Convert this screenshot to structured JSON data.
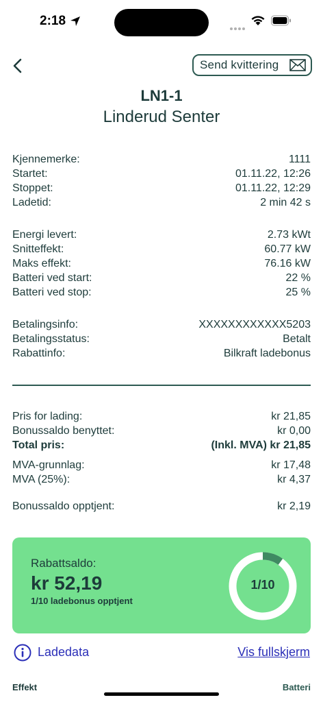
{
  "status_bar": {
    "time": "2:18"
  },
  "header": {
    "receipt_label": "Send kvittering",
    "station_id": "LN1-1",
    "station_name": "Linderud Senter"
  },
  "session": [
    {
      "label": "Kjennemerke:",
      "value": "1111"
    },
    {
      "label": "Startet:",
      "value": "01.11.22, 12:26"
    },
    {
      "label": "Stoppet:",
      "value": "01.11.22, 12:29"
    },
    {
      "label": "Ladetid:",
      "value": "2 min 42 s"
    }
  ],
  "energy": [
    {
      "label": "Energi levert:",
      "value": "2.73 kWt"
    },
    {
      "label": "Snitteffekt:",
      "value": "60.77 kW"
    },
    {
      "label": "Maks effekt:",
      "value": "76.16 kW"
    },
    {
      "label": "Batteri ved start:",
      "value": "22 %"
    },
    {
      "label": "Batteri ved stop:",
      "value": "25 %"
    }
  ],
  "payment": [
    {
      "label": "Betalingsinfo:",
      "value": "XXXXXXXXXXXX5203"
    },
    {
      "label": "Betalingsstatus:",
      "value": "Betalt"
    },
    {
      "label": "Rabattinfo:",
      "value": "Bilkraft ladebonus"
    }
  ],
  "pricing": [
    {
      "label": "Pris for lading:",
      "value": "kr 21,85"
    },
    {
      "label": "Bonussaldo benyttet:",
      "value": "kr 0,00"
    },
    {
      "label": "Total pris:",
      "value": "(Inkl. MVA) kr 21,85"
    },
    {
      "label": "MVA-grunnlag:",
      "value": "kr 17,48"
    },
    {
      "label": "MVA (25%):",
      "value": "kr 4,37"
    },
    {
      "label": "Bonussaldo opptjent:",
      "value": "kr 2,19"
    }
  ],
  "rabatt": {
    "label": "Rabattsaldo:",
    "amount": "kr 52,19",
    "progress_text": "1/10 ladebonus opptjent",
    "ring_text": "1/10",
    "progress_fraction": 0.1,
    "card_color": "#74e08f",
    "ring_fill_color": "#3f8a62"
  },
  "ladedata": {
    "label": "Ladedata",
    "fullscreen_link": "Vis fullskjerm",
    "legend_left": "Effekt",
    "legend_right": "Batteri"
  },
  "colors": {
    "text": "#1d3b3a",
    "accent": "#2d5a52",
    "link": "#2b2fb8"
  }
}
